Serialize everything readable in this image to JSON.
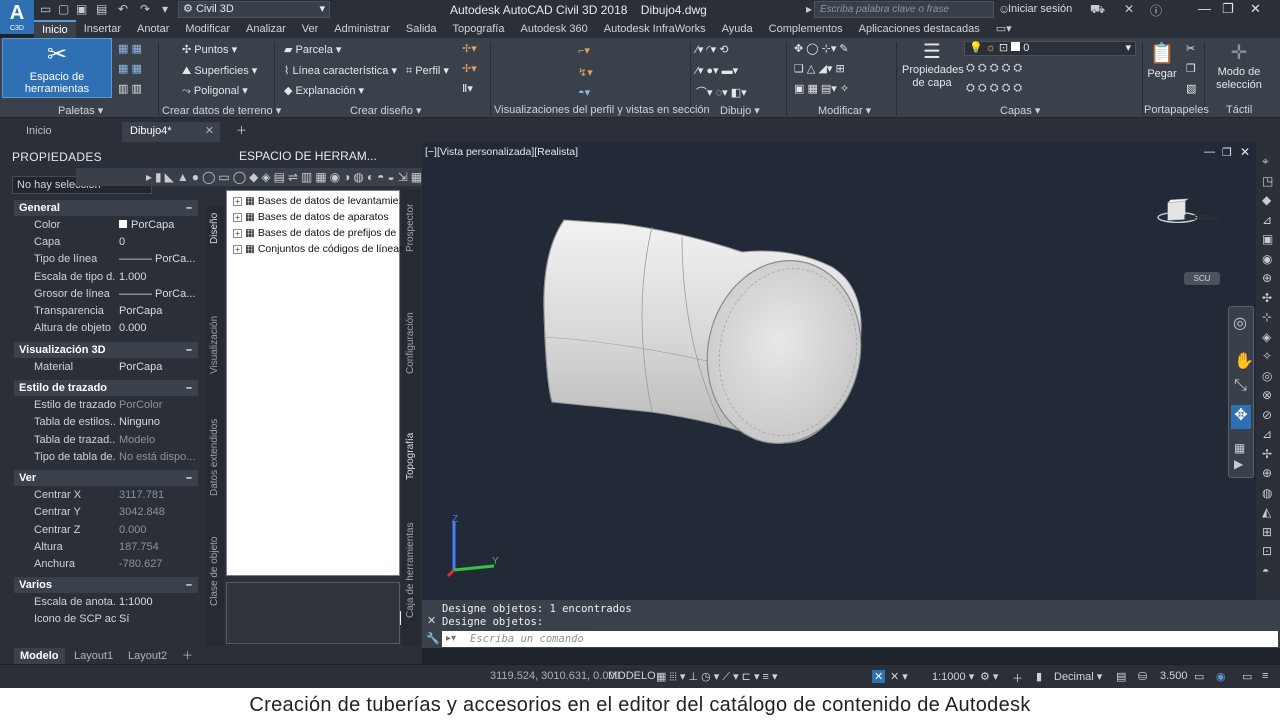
{
  "app": {
    "logo_main": "A",
    "logo_sub": "C3D",
    "workspace": "Civil 3D",
    "title": "Autodesk AutoCAD Civil 3D 2018",
    "document": "Dibujo4.dwg",
    "search_placeholder": "Escriba palabra clave o frase",
    "sign_in": "Iniciar sesión"
  },
  "ribbon_tabs": [
    "Inicio",
    "Insertar",
    "Anotar",
    "Modificar",
    "Analizar",
    "Ver",
    "Administrar",
    "Salida",
    "Topografía",
    "Autodesk 360",
    "Autodesk InfraWorks",
    "Ayuda",
    "Complementos",
    "Aplicaciones destacadas"
  ],
  "ribbon": {
    "big_tool": "Espacio de herramientas",
    "buttons": {
      "puntos": "Puntos",
      "superficies": "Superficies",
      "poligonal": "Poligonal",
      "parcela": "Parcela",
      "linea_caracteristica": "Línea característica",
      "perfil": "Perfil",
      "explanacion": "Explanación",
      "propiedades_capa": "Propiedades de capa",
      "pegar": "Pegar",
      "modo_seleccion": "Modo de selección",
      "layer_value": "0"
    },
    "panels": {
      "paletas": "Paletas",
      "crear_datos": "Crear datos de terreno",
      "crear_diseno": "Crear diseño",
      "visualizaciones": "Visualizaciones del perfil y vistas en sección",
      "dibujo": "Dibujo",
      "modificar": "Modificar",
      "capas": "Capas",
      "portapapeles": "Portapapeles",
      "tactil": "Táctil"
    }
  },
  "doc_tabs": {
    "inicio": "Inicio",
    "dibujo": "Dibujo4*"
  },
  "properties": {
    "title": "PROPIEDADES",
    "selection": "No hay selección",
    "side_tabs": [
      "Diseño",
      "Visualización",
      "Datos extendidos",
      "Clase de objeto"
    ],
    "general": {
      "title": "General",
      "rows": [
        {
          "k": "Color",
          "v": "PorCapa"
        },
        {
          "k": "Capa",
          "v": "0"
        },
        {
          "k": "Tipo de línea",
          "v": "——— PorCa..."
        },
        {
          "k": "Escala de tipo d...",
          "v": "1.000"
        },
        {
          "k": "Grosor de línea",
          "v": "——— PorCa..."
        },
        {
          "k": "Transparencia",
          "v": "PorCapa"
        },
        {
          "k": "Altura de objeto",
          "v": "0.000"
        }
      ]
    },
    "vis3d": {
      "title": "Visualización 3D",
      "rows": [
        {
          "k": "Material",
          "v": "PorCapa"
        }
      ]
    },
    "trazado": {
      "title": "Estilo de trazado",
      "rows": [
        {
          "k": "Estilo de trazado",
          "v": "PorColor",
          "dim": true
        },
        {
          "k": "Tabla de estilos...",
          "v": "Ninguno"
        },
        {
          "k": "Tabla de trazad...",
          "v": "Modelo",
          "dim": true
        },
        {
          "k": "Tipo de tabla de...",
          "v": "No está dispo...",
          "dim": true
        }
      ]
    },
    "ver": {
      "title": "Ver",
      "rows": [
        {
          "k": "Centrar X",
          "v": "3117.781",
          "dim": true
        },
        {
          "k": "Centrar Y",
          "v": "3042.848",
          "dim": true
        },
        {
          "k": "Centrar Z",
          "v": "0.000",
          "dim": true
        },
        {
          "k": "Altura",
          "v": "187.754",
          "dim": true
        },
        {
          "k": "Anchura",
          "v": "-780.627",
          "dim": true
        }
      ]
    },
    "varios": {
      "title": "Varios",
      "rows": [
        {
          "k": "Escala de anota...",
          "v": "1:1000"
        },
        {
          "k": "Icono de SCP ac...",
          "v": "Sí"
        }
      ]
    }
  },
  "toolspace": {
    "title": "ESPACIO DE HERRAM...",
    "side_tabs": [
      "Prospector",
      "Configuración",
      "Topografía",
      "Caja de herramientas"
    ],
    "tree": [
      "Bases de datos de levantamie...",
      "Bases de datos de aparatos",
      "Bases de datos de prefijos de ...",
      "Conjuntos de códigos de líneas"
    ]
  },
  "viewport": {
    "label": "[−][Vista personalizada][Realista]",
    "viewcube_face": "DERECHA",
    "ucs_label": "SCU",
    "axis_z": "Z",
    "axis_y": "Y"
  },
  "command": {
    "line1": "Designe objetos: 1 encontrados",
    "line2": "Designe objetos:",
    "placeholder": "Escriba un comando"
  },
  "layout_tabs": [
    "Modelo",
    "Layout1",
    "Layout2"
  ],
  "status": {
    "coords": "3119.524, 3010.631, 0.000",
    "mode": "MODELO",
    "scale": "1:1000",
    "units": "Decimal",
    "value": "3.500"
  },
  "caption": "Creación de tuberías y accesorios en el editor del catálogo de contenido de Autodesk",
  "colors": {
    "accent": "#2f6fb3",
    "viewport_bg": "#222a38",
    "panel_bg": "#2b3038",
    "ribbon_bg": "#3b414a"
  }
}
